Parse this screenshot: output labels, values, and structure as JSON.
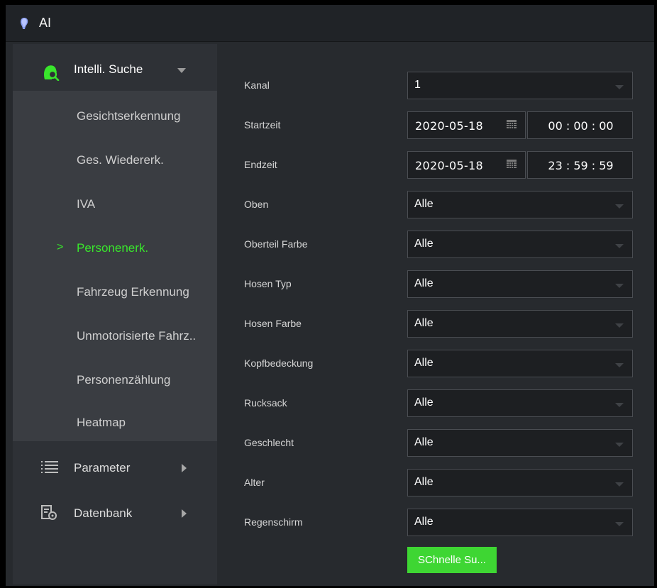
{
  "window": {
    "title": "AI",
    "app_icon": "bulb-icon"
  },
  "sidebar": {
    "header": {
      "label": "Intelli. Suche",
      "icon": "face-search-icon"
    },
    "items": [
      {
        "label": "Gesichtserkennung",
        "active": false
      },
      {
        "label": "Ges. Wiedererk.",
        "active": false
      },
      {
        "label": "IVA",
        "active": false
      },
      {
        "label": "Personenerk.",
        "active": true,
        "marker": ">"
      },
      {
        "label": "Fahrzeug Erkennung",
        "active": false
      },
      {
        "label": "Unmotorisierte Fahrz..",
        "active": false
      },
      {
        "label": "Personenzählung",
        "active": false
      },
      {
        "label": "Heatmap",
        "active": false
      }
    ],
    "groups": [
      {
        "label": "Parameter",
        "icon": "list-icon"
      },
      {
        "label": "Datenbank",
        "icon": "database-settings-icon"
      }
    ]
  },
  "form": {
    "kanal": {
      "label": "Kanal",
      "value": "1"
    },
    "startzeit": {
      "label": "Startzeit",
      "date": "2020-05-18",
      "time": "00 : 00 : 00"
    },
    "endzeit": {
      "label": "Endzeit",
      "date": "2020-05-18",
      "time": "23 : 59 : 59"
    },
    "selects": [
      {
        "label": "Oben",
        "value": "Alle"
      },
      {
        "label": "Oberteil Farbe",
        "value": "Alle"
      },
      {
        "label": "Hosen Typ",
        "value": "Alle"
      },
      {
        "label": "Hosen Farbe",
        "value": "Alle"
      },
      {
        "label": "Kopfbedeckung",
        "value": "Alle"
      },
      {
        "label": "Rucksack",
        "value": "Alle"
      },
      {
        "label": "Geschlecht",
        "value": "Alle"
      },
      {
        "label": "Alter",
        "value": "Alle"
      },
      {
        "label": "Regenschirm",
        "value": "Alle"
      }
    ],
    "search_button": "SChnelle Su..."
  },
  "colors": {
    "accent_green": "#39e62c",
    "button_green": "#3ed633",
    "background": "#272a2e",
    "sidebar": "#2e3136",
    "sidebar_submenu": "#3a3d42",
    "input_bg": "#1d1f22"
  }
}
